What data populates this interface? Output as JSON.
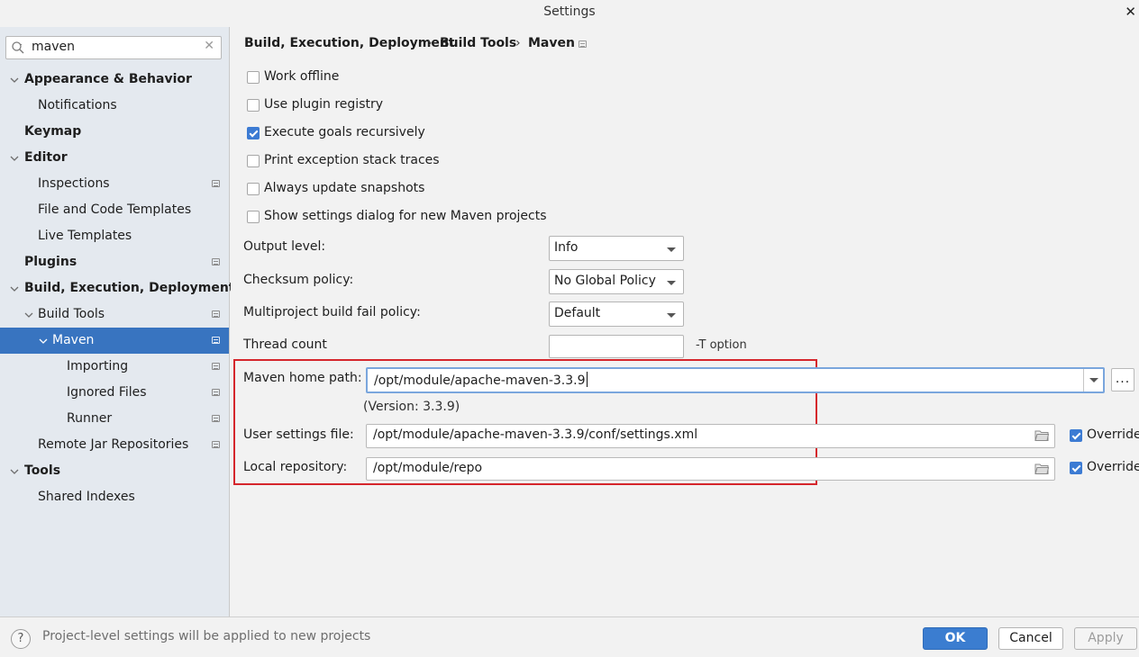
{
  "window": {
    "title": "Settings",
    "close_glyph": "✕"
  },
  "search": {
    "value": "maven",
    "clear_glyph": "✕",
    "icon": "search-icon"
  },
  "sidebar": {
    "items": [
      {
        "label": "Appearance & Behavior",
        "bold": true,
        "expanded": true
      },
      {
        "label": "Notifications"
      },
      {
        "label": "Keymap",
        "bold": true
      },
      {
        "label": "Editor",
        "bold": true,
        "expanded": true
      },
      {
        "label": "Inspections",
        "project_level": true
      },
      {
        "label": "File and Code Templates"
      },
      {
        "label": "Live Templates"
      },
      {
        "label": "Plugins",
        "bold": true,
        "project_level": true
      },
      {
        "label": "Build, Execution, Deployment",
        "bold": true,
        "expanded": true
      },
      {
        "label": "Build Tools",
        "expanded": true,
        "project_level": true
      },
      {
        "label": "Maven",
        "selected": true,
        "expanded": true,
        "project_level": true
      },
      {
        "label": "Importing",
        "project_level": true
      },
      {
        "label": "Ignored Files",
        "project_level": true
      },
      {
        "label": "Runner",
        "project_level": true
      },
      {
        "label": "Remote Jar Repositories",
        "project_level": true
      },
      {
        "label": "Tools",
        "bold": true,
        "expanded": true
      },
      {
        "label": "Shared Indexes"
      }
    ]
  },
  "breadcrumb": {
    "parts": [
      "Build, Execution, Deployment",
      "Build Tools",
      "Maven"
    ],
    "separator": "›"
  },
  "options": [
    {
      "label": "Work offline",
      "checked": false
    },
    {
      "label": "Use plugin registry",
      "checked": false
    },
    {
      "label": "Execute goals recursively",
      "checked": true
    },
    {
      "label": "Print exception stack traces",
      "checked": false
    },
    {
      "label": "Always update snapshots",
      "checked": false
    },
    {
      "label": "Show settings dialog for new Maven projects",
      "checked": false
    }
  ],
  "fields": {
    "output_level": {
      "label": "Output level:",
      "value": "Info"
    },
    "checksum_policy": {
      "label": "Checksum policy:",
      "value": "No Global Policy"
    },
    "fail_policy": {
      "label": "Multiproject build fail policy:",
      "value": "Default"
    },
    "thread_count": {
      "label": "Thread count",
      "value": "",
      "hint": "-T option"
    },
    "maven_home": {
      "label": "Maven home path:",
      "value": "/opt/module/apache-maven-3.3.9",
      "version": "(Version: 3.3.9)",
      "browse": "..."
    },
    "user_settings": {
      "label": "User settings file:",
      "value": "/opt/module/apache-maven-3.3.9/conf/settings.xml",
      "override_label": "Override",
      "override_checked": true
    },
    "local_repo": {
      "label": "Local repository:",
      "value": "/opt/module/repo",
      "override_label": "Override",
      "override_checked": true
    }
  },
  "footer": {
    "help": "?",
    "status": "Project-level settings will be applied to new projects",
    "ok": "OK",
    "cancel": "Cancel",
    "apply": "Apply"
  },
  "colors": {
    "selection": "#3874c0",
    "highlight_box": "#d5262c",
    "primary_button": "#3b7dd0"
  }
}
